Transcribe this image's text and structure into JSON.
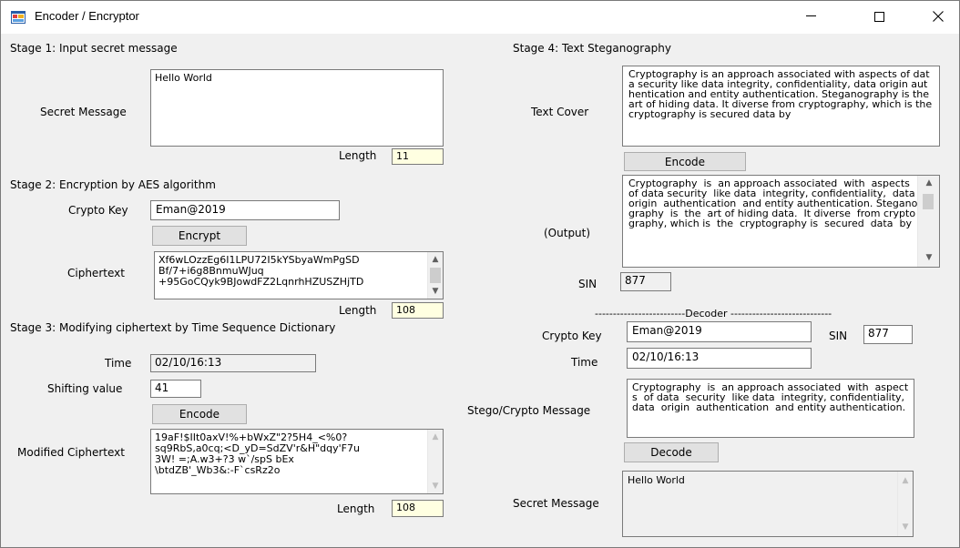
{
  "window": {
    "title": "Encoder / Encryptor",
    "minimize_glyph": "—",
    "maximize_glyph": "☐",
    "close_glyph": "✕"
  },
  "stage1": {
    "heading": "Stage 1: Input secret message",
    "secret_label": "Secret Message",
    "secret_value": "Hello World",
    "length_label": "Length",
    "length_value": "11"
  },
  "stage2": {
    "heading": "Stage 2:  Encryption by AES algorithm",
    "key_label": "Crypto Key",
    "key_value": "Eman@2019",
    "encrypt_label": "Encrypt",
    "cipher_label": "Ciphertext",
    "cipher_value": "Xf6wLOzzEg6I1LPU72I5kYSbyaWmPgSD\nBf/7+i6g8BnmuWJuq\n+95GoCQyk9BJowdFZ2LqnrhHZUSZHjTD",
    "length_label": "Length",
    "length_value": "108"
  },
  "stage3": {
    "heading": "Stage 3:  Modifying ciphertext by Time Sequence Dictionary",
    "time_label": "Time",
    "time_value": "02/10/16:13",
    "shift_label": "Shifting value",
    "shift_value": "41",
    "encode_label": "Encode",
    "modified_label": "Modified Ciphertext",
    "modified_value": "19aF!$IIt0axV!%+bWxZ\"2?5H4_<%0?\nsq9RbS,a0cq;<D_yD=SdZV'r&H\"dqy'F7u\n3W! =;A.w3+?3 w`/spS bEx\n\\btdZB'_Wb3&:-F`csRz2o",
    "length_label": "Length",
    "length_value": "108"
  },
  "stage4": {
    "heading": "Stage 4: Text Steganography",
    "cover_label": "Text Cover",
    "cover_value": "Cryptography is an approach associated with aspects of data security like data integrity, confidentiality, data origin authentication and entity authentication. Steganography is the art of hiding data. It diverse from cryptography, which is the cryptography is secured data by",
    "encode_label": "Encode",
    "output_label": "(Output)",
    "output_value": "Cryptography  is  an approach associated  with  aspects  of data security  like data  integrity, confidentiality,  data  origin  authentication  and entity authentication. Steganography  is  the  art of hiding data.  It diverse  from cryptography, which is  the  cryptography is  secured  data  by",
    "sin_label": "SIN",
    "sin_value": "877"
  },
  "decoder": {
    "separator": "-------------------------Decoder ----------------------------",
    "key_label": "Crypto Key",
    "key_value": "Eman@2019",
    "sin_label": "SIN",
    "sin_value": "877",
    "time_label": "Time",
    "time_value": "02/10/16:13",
    "stego_label": "Stego/Crypto Message",
    "stego_value": "Cryptography  is  an approach associated  with  aspects  of data  security  like data  integrity, confidentiality,  data  origin  authentication  and entity authentication.",
    "decode_label": "Decode",
    "secret_label": "Secret Message",
    "secret_value": "Hello World"
  },
  "icons": {
    "app": "app-icon",
    "scroll_up": "▲",
    "scroll_down": "▼"
  }
}
